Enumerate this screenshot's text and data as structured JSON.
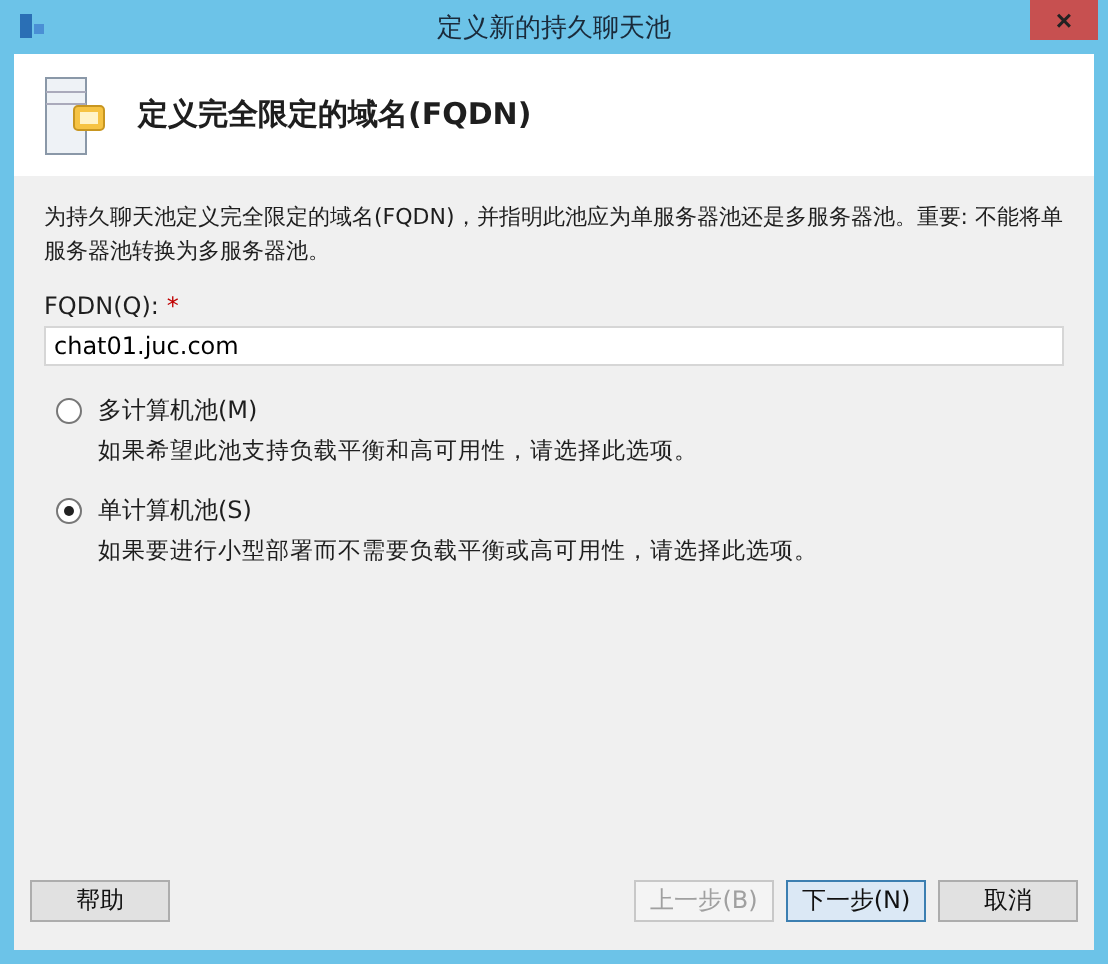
{
  "window": {
    "title": "定义新的持久聊天池",
    "close": "×"
  },
  "header": {
    "title": "定义完全限定的域名(FQDN)"
  },
  "description": "为持久聊天池定义完全限定的域名(FQDN)，并指明此池应为单服务器池还是多服务器池。重要: 不能将单服务器池转换为多服务器池。",
  "fqdn": {
    "label": "FQDN(Q):",
    "required": "*",
    "value": "chat01.juc.com"
  },
  "options": [
    {
      "label": "多计算机池(M)",
      "hint": "如果希望此池支持负载平衡和高可用性，请选择此选项。",
      "selected": false
    },
    {
      "label": "单计算机池(S)",
      "hint": "如果要进行小型部署而不需要负载平衡或高可用性，请选择此选项。",
      "selected": true
    }
  ],
  "buttons": [
    {
      "label": "帮助",
      "kind": "left",
      "disabled": false,
      "default": false
    },
    {
      "label": "上一步(B)",
      "kind": "right",
      "disabled": true,
      "default": false
    },
    {
      "label": "下一步(N)",
      "kind": "right",
      "disabled": false,
      "default": true
    },
    {
      "label": "取消",
      "kind": "right",
      "disabled": false,
      "default": false
    }
  ]
}
